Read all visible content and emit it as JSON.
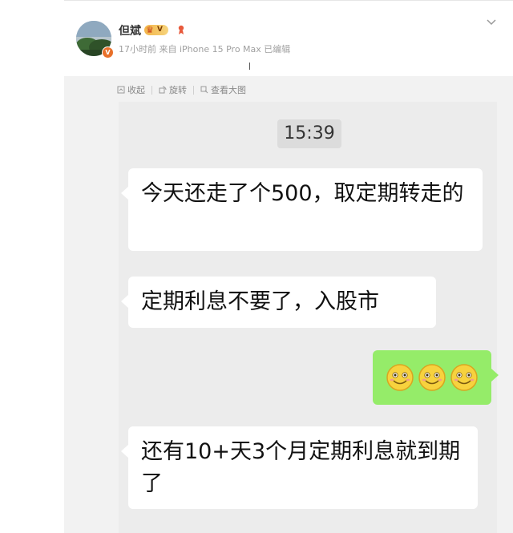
{
  "post": {
    "username": "但斌",
    "vip_text": "V",
    "meta": "17小时前 来自 iPhone 15 Pro Max 已编辑",
    "avatar_badge": "V"
  },
  "toolbar": {
    "collapse_label": "收起",
    "rotate_label": "旋转",
    "view_large_label": "查看大图"
  },
  "chat": {
    "time": "15:39",
    "messages": [
      {
        "direction": "incoming",
        "text": "今天还走了个500，取定期转走的"
      },
      {
        "direction": "incoming",
        "text": "定期利息不要了，入股市"
      },
      {
        "direction": "outgoing",
        "emoji": [
          "smile-emoji",
          "smile-emoji",
          "smile-emoji"
        ]
      },
      {
        "direction": "incoming",
        "text": "还有10+天3个月定期利息就到期了"
      }
    ]
  },
  "colors": {
    "outgoing_bubble": "#95ec69",
    "incoming_bubble": "#ffffff",
    "chat_background": "#ececec"
  }
}
